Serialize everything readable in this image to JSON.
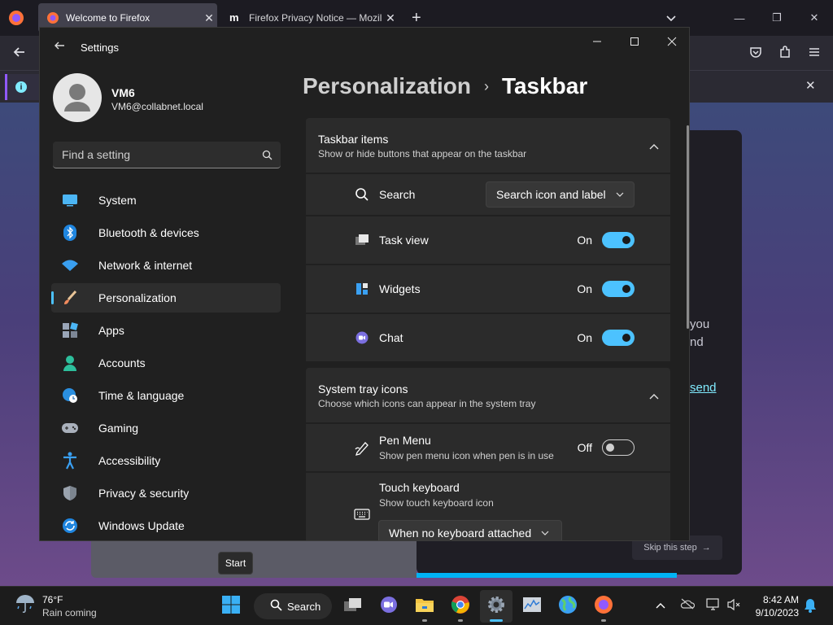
{
  "browser": {
    "tabs": [
      {
        "title": "Welcome to Firefox",
        "active": true
      },
      {
        "title": "Firefox Privacy Notice — Mozill",
        "active": false
      }
    ],
    "new_tab": "+",
    "content": {
      "text_line1": "you",
      "text_line2": "nd",
      "link_text": "send",
      "skip_label": "Skip this step",
      "progress_fraction": 0.8
    }
  },
  "settings": {
    "app_title": "Settings",
    "profile": {
      "name": "VM6",
      "email": "VM6@collabnet.local"
    },
    "search_placeholder": "Find a setting",
    "nav": [
      {
        "label": "System",
        "icon": "system-icon"
      },
      {
        "label": "Bluetooth & devices",
        "icon": "bluetooth-icon"
      },
      {
        "label": "Network & internet",
        "icon": "wifi-icon"
      },
      {
        "label": "Personalization",
        "icon": "brush-icon",
        "selected": true
      },
      {
        "label": "Apps",
        "icon": "apps-icon"
      },
      {
        "label": "Accounts",
        "icon": "accounts-icon"
      },
      {
        "label": "Time & language",
        "icon": "globe-clock-icon"
      },
      {
        "label": "Gaming",
        "icon": "gamepad-icon"
      },
      {
        "label": "Accessibility",
        "icon": "accessibility-icon"
      },
      {
        "label": "Privacy & security",
        "icon": "shield-icon"
      },
      {
        "label": "Windows Update",
        "icon": "update-icon"
      }
    ],
    "breadcrumb": {
      "parent": "Personalization",
      "separator": "›",
      "current": "Taskbar"
    },
    "taskbar_items": {
      "title": "Taskbar items",
      "description": "Show or hide buttons that appear on the taskbar",
      "search": {
        "label": "Search",
        "value": "Search icon and label"
      },
      "task_view": {
        "label": "Task view",
        "state": "On"
      },
      "widgets": {
        "label": "Widgets",
        "state": "On"
      },
      "chat": {
        "label": "Chat",
        "state": "On"
      }
    },
    "system_tray": {
      "title": "System tray icons",
      "description": "Choose which icons can appear in the system tray",
      "pen_menu": {
        "label": "Pen Menu",
        "sub": "Show pen menu icon when pen is in use",
        "state": "Off"
      },
      "touch_keyboard": {
        "label": "Touch keyboard",
        "sub": "Show touch keyboard icon",
        "value": "When no keyboard attached"
      }
    }
  },
  "tooltip": "Start",
  "taskbar": {
    "weather": {
      "temp": "76°F",
      "condition": "Rain coming"
    },
    "search_label": "Search",
    "clock": {
      "time": "8:42 AM",
      "date": "9/10/2023"
    }
  },
  "colors": {
    "accent": "#4cc2ff",
    "firefox_purple": "#9059ff",
    "settings_bg": "#202020"
  }
}
